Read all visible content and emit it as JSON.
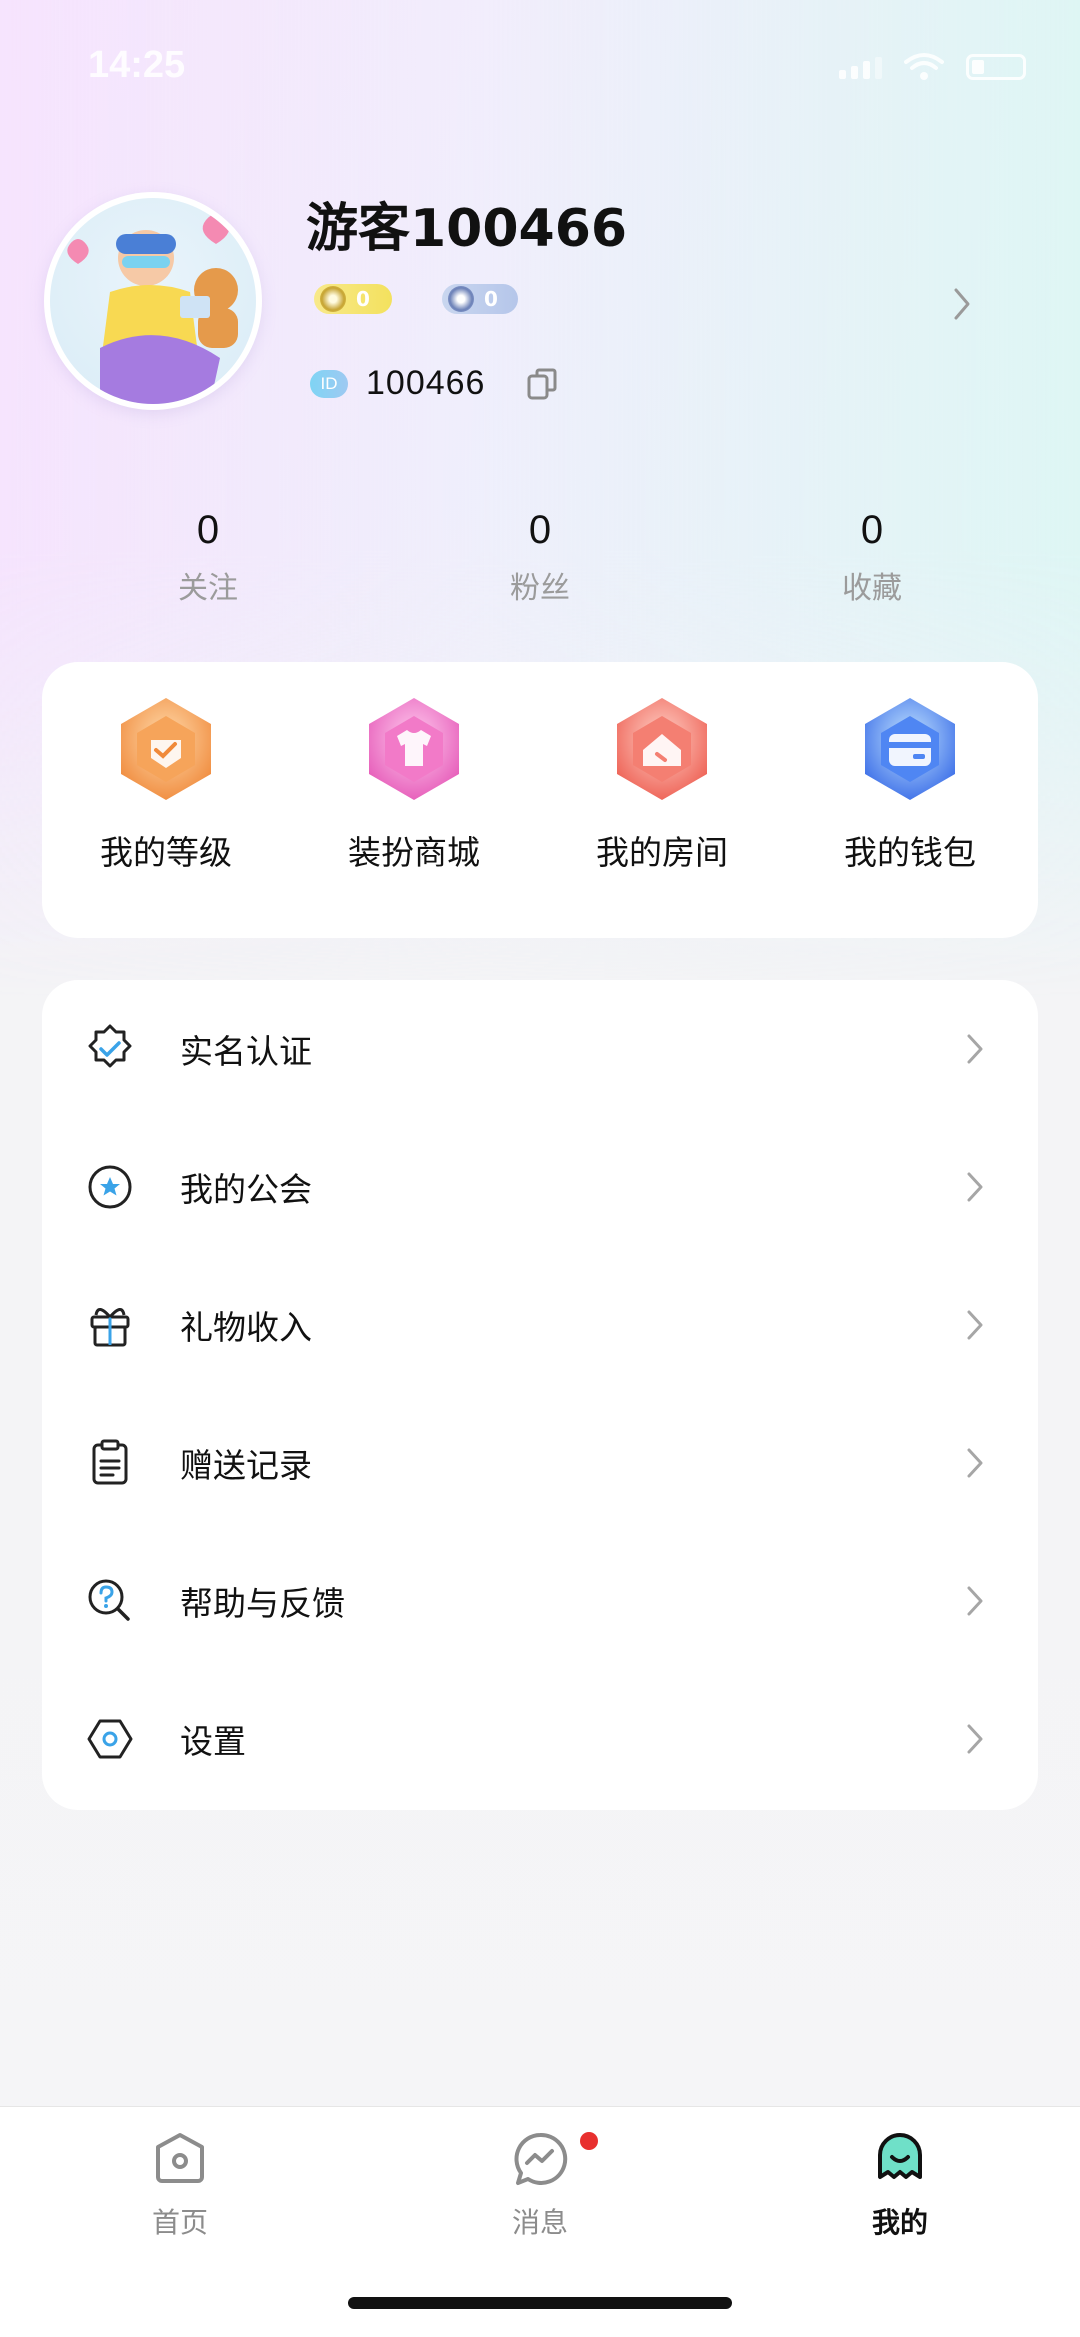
{
  "status_bar": {
    "time": "14:25"
  },
  "profile": {
    "username": "游客100466",
    "level_badge": "0",
    "vip_badge": "0",
    "id_tag": "ID",
    "id_number": "100466"
  },
  "stats": [
    {
      "value": "0",
      "label": "关注"
    },
    {
      "value": "0",
      "label": "粉丝"
    },
    {
      "value": "0",
      "label": "收藏"
    }
  ],
  "features": [
    {
      "label": "我的等级",
      "icon": "level-icon",
      "color": "#f6a45a"
    },
    {
      "label": "装扮商城",
      "icon": "tshirt-icon",
      "color": "#f27ac8"
    },
    {
      "label": "我的房间",
      "icon": "house-icon",
      "color": "#f47f72"
    },
    {
      "label": "我的钱包",
      "icon": "wallet-icon",
      "color": "#4f86f3"
    }
  ],
  "menu": [
    {
      "label": "实名认证",
      "icon": "verified-badge-icon"
    },
    {
      "label": "我的公会",
      "icon": "guild-star-icon"
    },
    {
      "label": "礼物收入",
      "icon": "gift-icon"
    },
    {
      "label": "赠送记录",
      "icon": "clipboard-icon"
    },
    {
      "label": "帮助与反馈",
      "icon": "help-search-icon"
    },
    {
      "label": "设置",
      "icon": "settings-hex-icon"
    }
  ],
  "tabs": [
    {
      "label": "首页",
      "icon": "home-icon",
      "active": false
    },
    {
      "label": "消息",
      "icon": "message-icon",
      "active": false,
      "badge": true
    },
    {
      "label": "我的",
      "icon": "profile-icon",
      "active": true
    }
  ],
  "colors": {
    "accent_teal": "#6fe0c8",
    "badge_red": "#e8302f",
    "icon_blue": "#3aa3e8"
  }
}
